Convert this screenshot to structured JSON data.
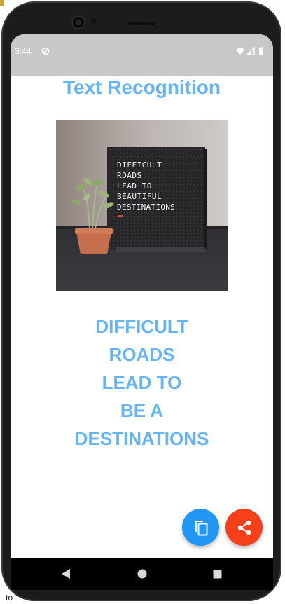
{
  "status_bar": {
    "time": "3:44",
    "notification_icon": "circle-slash-icon",
    "icons": [
      "wifi-icon",
      "signal-icon",
      "battery-icon"
    ]
  },
  "app": {
    "title": "Text Recognition"
  },
  "photo": {
    "sign_lines": [
      "DIFFICULT",
      "ROADS",
      "LEAD TO",
      "BEAUTIFUL",
      "DESTINATIONS"
    ]
  },
  "result": {
    "lines": [
      "DIFFICULT",
      "ROADS",
      "LEAD TO",
      "BE A",
      "DESTINATIONS"
    ]
  },
  "actions": {
    "copy_icon": "copy-icon",
    "share_icon": "share-icon"
  },
  "nav": {
    "back_icon": "back-icon",
    "home_icon": "home-icon",
    "recents_icon": "recents-icon"
  },
  "colors": {
    "accent_text": "#64b5f6",
    "copy_fab": "#2196f3",
    "share_fab": "#f4411c",
    "status_bar": "#c8c8c8"
  },
  "background": {
    "bottom_text": "to"
  }
}
